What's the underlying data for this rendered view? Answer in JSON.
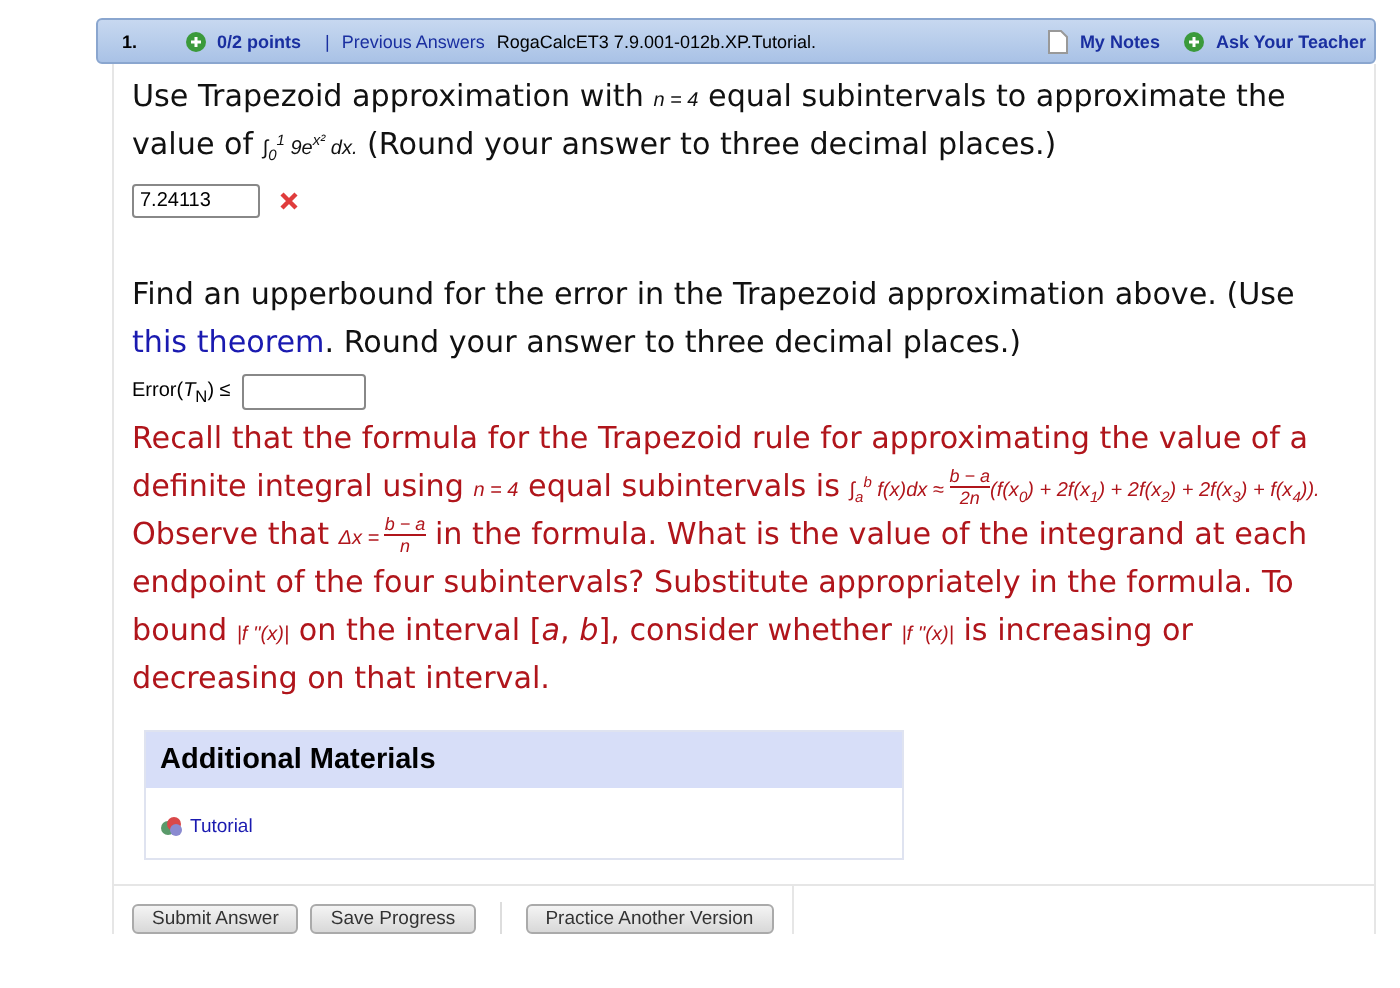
{
  "header": {
    "number": "1.",
    "points": "0/2 points",
    "separator": "|",
    "previous_answers": "Previous Answers",
    "source": "RogaCalcET3 7.9.001-012b.XP.Tutorial.",
    "my_notes": "My Notes",
    "ask_teacher": "Ask Your Teacher"
  },
  "parts": [
    {
      "kind": "question",
      "segments": [
        {
          "kind": "text",
          "text": "Use Trapezoid approximation with "
        },
        {
          "kind": "math",
          "text": "n = 4"
        },
        {
          "kind": "text",
          "text": " equal subintervals to approximate the value of "
        },
        {
          "kind": "math",
          "text": "∫$_{0}$$^{1}$ 9e$^{x²}$ dx."
        },
        {
          "kind": "text",
          "text": " (Round your answer to three decimal places.)"
        }
      ]
    },
    {
      "kind": "answer",
      "value": "7.24113",
      "incorrect": true
    },
    {
      "kind": "question",
      "segments": [
        {
          "kind": "text",
          "text": "Find an upperbound for the error in the Trapezoid approximation above. (Use "
        },
        {
          "kind": "link",
          "text": "this theorem"
        },
        {
          "kind": "text",
          "text": ". Round your answer to three decimal places.)"
        }
      ]
    },
    {
      "kind": "answer",
      "label": "Error(*T*$_{N}$) ≤",
      "incorrect": false
    },
    {
      "kind": "hint",
      "segments": [
        {
          "kind": "text",
          "text": "Recall that the formula for the Trapezoid rule for approximating the value of a definite integral using "
        },
        {
          "kind": "math",
          "text": "n = 4"
        },
        {
          "kind": "text",
          "text": " equal subintervals is "
        },
        {
          "kind": "math",
          "text": "∫$_{a}$$^{b}$ f(x)dx ≈ "
        },
        {
          "kind": "frac",
          "num": "b − a",
          "den": "2n"
        },
        {
          "kind": "math",
          "text": "(f(x$_{0}$) + 2f(x$_{1}$) + 2f(x$_{2}$) + 2f(x$_{3}$) + f(x$_{4}$))."
        },
        {
          "kind": "text",
          "text": " Observe that "
        },
        {
          "kind": "math",
          "text": "Δx = "
        },
        {
          "kind": "frac",
          "num": "b − a",
          "den": "n"
        },
        {
          "kind": "text",
          "text": " in the formula. What is the value of the integrand at each endpoint of the four subintervals? Substitute appropriately in the formula. To bound "
        },
        {
          "kind": "math",
          "text": "|f ''(x)|"
        },
        {
          "kind": "text",
          "text": " on the interval ["
        },
        {
          "kind": "text",
          "text": "*a*, *b*"
        },
        {
          "kind": "text",
          "text": "], consider whether "
        },
        {
          "kind": "math",
          "text": "|f ''(x)|"
        },
        {
          "kind": "text",
          "text": " is increasing or decreasing on that interval."
        }
      ]
    }
  ],
  "materials": {
    "title": "Additional Materials",
    "items": [
      "Tutorial"
    ]
  },
  "buttons": [
    "Submit Answer",
    "Save Progress",
    "Practice Another Version"
  ]
}
